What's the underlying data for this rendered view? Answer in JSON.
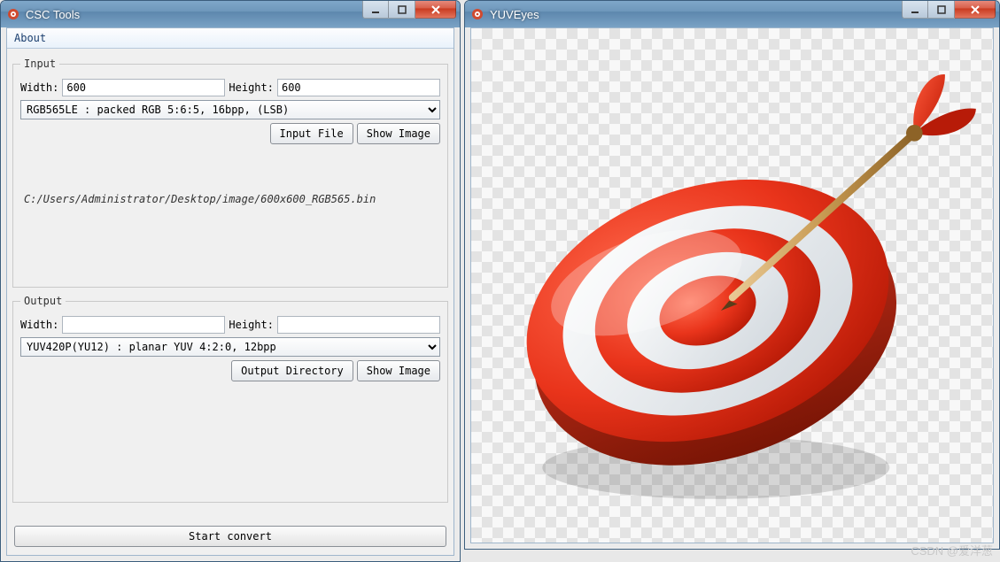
{
  "left_window": {
    "title": "CSC Tools",
    "menu": {
      "about": "About"
    },
    "input": {
      "legend": "Input",
      "width_label": "Width:",
      "width_value": "600",
      "height_label": "Height:",
      "height_value": "600",
      "format_selected": "RGB565LE : packed RGB 5:6:5, 16bpp, (LSB)",
      "btn_input_file": "Input File",
      "btn_show_image": "Show Image",
      "file_path": "C:/Users/Administrator/Desktop/image/600x600_RGB565.bin"
    },
    "output": {
      "legend": "Output",
      "width_label": "Width:",
      "width_value": "",
      "height_label": "Height:",
      "height_value": "",
      "format_selected": "YUV420P(YU12) : planar YUV 4:2:0, 12bpp",
      "btn_output_dir": "Output Directory",
      "btn_show_image": "Show Image"
    },
    "start_button": "Start convert"
  },
  "right_window": {
    "title": "YUVEyes",
    "image_description": "target-with-dart-icon"
  },
  "watermark": "CSDN @爱洋葱"
}
